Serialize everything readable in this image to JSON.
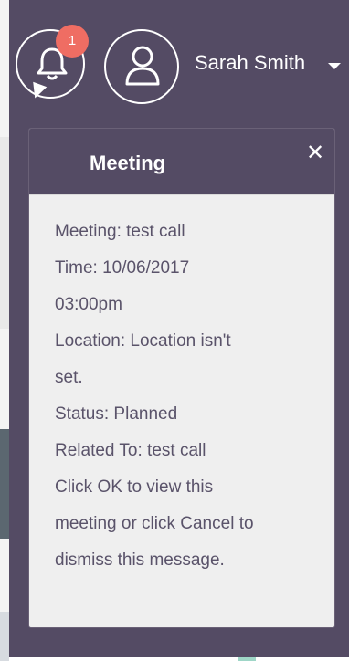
{
  "header": {
    "notification_count": "1",
    "user_name": "Sarah Smith"
  },
  "icons": {
    "bell": "bell-icon",
    "user": "user-icon",
    "caret": "chevron-down-icon",
    "close": "close-icon"
  },
  "colors": {
    "panel": "#544b64",
    "badge": "#ef6d63",
    "popover_bg": "#efefef",
    "body_text": "#5a536a"
  },
  "popover": {
    "title": "Meeting",
    "close_label": "✕",
    "lines": [
      "Meeting: test call",
      "Time: 10/06/2017",
      "03:00pm",
      "Location: Location isn't",
      "set.",
      "Status: Planned",
      "Related To: test call",
      "Click OK to view this",
      "meeting or click Cancel to",
      "dismiss this message."
    ]
  }
}
